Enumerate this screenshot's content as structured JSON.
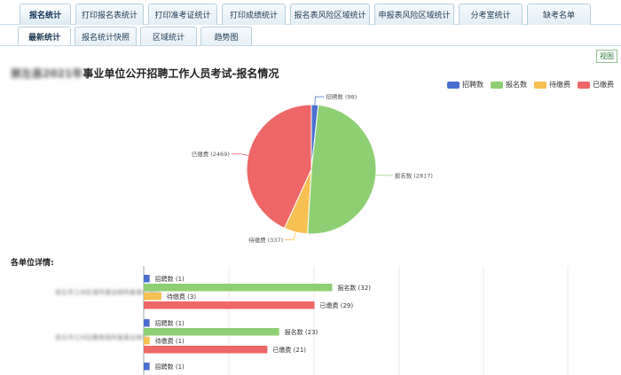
{
  "tabs_primary": [
    "报名统计",
    "打印报名表统计",
    "打印准考证统计",
    "打印成绩统计",
    "报名表风险区域统计",
    "申报表风险区域统计",
    "分考室统计",
    "缺考名单"
  ],
  "tabs_secondary": [
    "最新统计",
    "报名统计快照",
    "区域统计",
    "趋势图"
  ],
  "view_button": "视图",
  "title_blurred": "崇左县2021年",
  "title_main": "事业单位公开招聘工作人员考试-报名情况",
  "section_title": "各单位详情:",
  "colors": {
    "招聘数": "#4a6fd0",
    "报名数": "#8fcf74",
    "待缴费": "#f6c052",
    "已缴费": "#ee6667"
  },
  "chart_data": {
    "type": "pie",
    "slices": [
      {
        "name": "招聘数",
        "value": 98
      },
      {
        "name": "报名数",
        "value": 2817
      },
      {
        "name": "待缴费",
        "value": 337
      },
      {
        "name": "已缴费",
        "value": 2469
      }
    ],
    "legend": [
      "招聘数",
      "报名数",
      "待缴费",
      "已缴费"
    ],
    "legend_position": "top-right"
  },
  "pie_labels": {
    "招聘数": "招聘数 (98)",
    "报名数": "报名数 (2817)",
    "待缴费": "待缴费 (337)",
    "已缴费": "已缴费 (2469)"
  },
  "units": [
    {
      "name": "崇左市江州区城市建设局所属事业单位",
      "bars": [
        {
          "name": "招聘数",
          "value": 1,
          "label": "招聘数 (1)"
        },
        {
          "name": "报名数",
          "value": 32,
          "label": "报名数 (32)"
        },
        {
          "name": "待缴费",
          "value": 3,
          "label": "待缴费 (3)"
        },
        {
          "name": "已缴费",
          "value": 29,
          "label": "已缴费 (29)"
        }
      ]
    },
    {
      "name": "崇左市江州区教育局所属事业单位",
      "bars": [
        {
          "name": "招聘数",
          "value": 1,
          "label": "招聘数 (1)"
        },
        {
          "name": "报名数",
          "value": 23,
          "label": "报名数 (23)"
        },
        {
          "name": "待缴费",
          "value": 1,
          "label": "待缴费 (1)"
        },
        {
          "name": "已缴费",
          "value": 21,
          "label": "已缴费 (21)"
        }
      ]
    },
    {
      "name": "",
      "bars": [
        {
          "name": "招聘数",
          "value": 1,
          "label": "招聘数 (1)"
        }
      ]
    }
  ]
}
